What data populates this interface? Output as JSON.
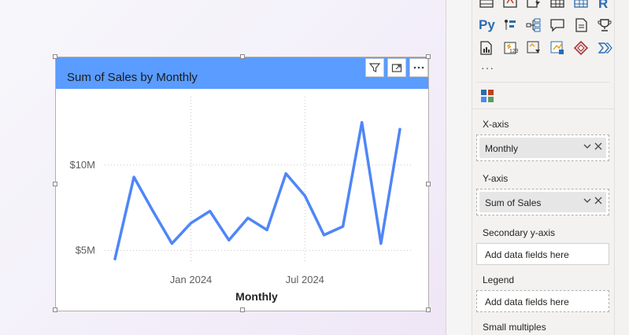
{
  "visual": {
    "title": "Sum of Sales by Monthly",
    "header_buttons": [
      "filter-icon",
      "focus-mode-icon",
      "more-options-icon"
    ]
  },
  "chart_data": {
    "type": "line",
    "title": "Sum of Sales by Monthly",
    "xlabel": "Monthly",
    "ylabel": "",
    "x": [
      "2023-09",
      "2023-10",
      "2023-11",
      "2023-12",
      "2024-01",
      "2024-02",
      "2024-03",
      "2024-04",
      "2024-05",
      "2024-06",
      "2024-07",
      "2024-08",
      "2024-09",
      "2024-10",
      "2024-11",
      "2024-12"
    ],
    "series": [
      {
        "values": [
          4.5,
          9.3,
          7.3,
          5.4,
          6.6,
          7.3,
          5.6,
          6.9,
          6.2,
          9.5,
          8.2,
          5.9,
          6.4,
          12.5,
          5.4,
          12.1
        ]
      }
    ],
    "x_ticks": [
      "Jan 2024",
      "Jul 2024"
    ],
    "y_ticks": [
      "$5M",
      "$10M"
    ],
    "ylim": [
      3.5,
      14
    ],
    "color": "#4f86f7",
    "grid": true
  },
  "fields": {
    "visuals_more": "···",
    "x_axis": {
      "label": "X-axis",
      "field": "Monthly"
    },
    "y_axis": {
      "label": "Y-axis",
      "field": "Sum of Sales"
    },
    "secondary_y": {
      "label": "Secondary y-axis",
      "placeholder": "Add data fields here"
    },
    "legend": {
      "label": "Legend",
      "placeholder": "Add data fields here"
    },
    "small_multiples": {
      "label": "Small multiples"
    }
  },
  "viz_gallery": {
    "r_label": "R",
    "py_label": "Py",
    "icons": [
      "table-icon",
      "matrix-icon",
      "r-visual-icon",
      "python-visual-icon",
      "key-influencers-icon",
      "decomposition-tree-icon",
      "qa-icon",
      "paginated-report-icon",
      "goals-trophy-icon",
      "kpi-icon",
      "card-icon",
      "smart-narrative-icon",
      "power-apps-icon",
      "power-automate-icon",
      "format-icon"
    ]
  }
}
